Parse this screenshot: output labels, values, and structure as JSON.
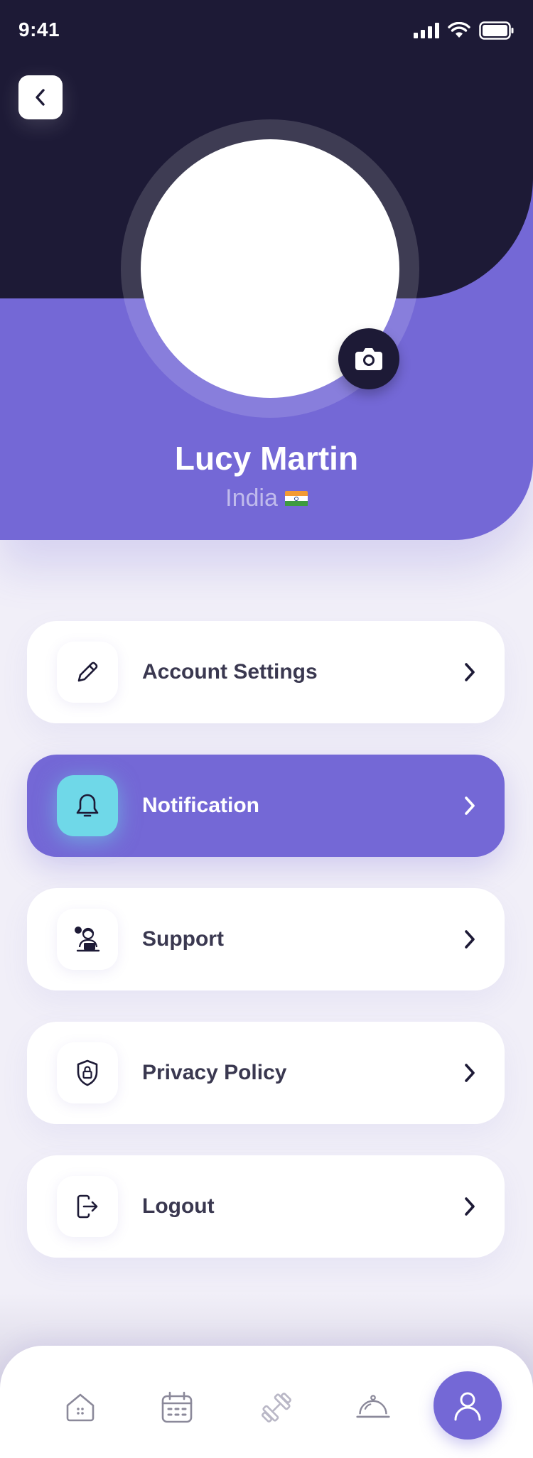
{
  "status_bar": {
    "time": "9:41"
  },
  "profile": {
    "name": "Lucy Martin",
    "country": "India"
  },
  "menu": {
    "items": [
      {
        "label": "Account Settings",
        "icon": "pencil-icon",
        "active": false
      },
      {
        "label": "Notification",
        "icon": "bell-icon",
        "active": true
      },
      {
        "label": "Support",
        "icon": "support-agent-icon",
        "active": false
      },
      {
        "label": "Privacy Policy",
        "icon": "shield-lock-icon",
        "active": false
      },
      {
        "label": "Logout",
        "icon": "logout-icon",
        "active": false
      }
    ]
  },
  "bottom_nav": {
    "items": [
      "home-icon",
      "calendar-icon",
      "dumbbell-icon",
      "food-cloche-icon",
      "profile-icon"
    ],
    "active": "profile-icon"
  },
  "colors": {
    "dark_header": "#1d1a36",
    "accent_purple": "#7468d6",
    "highlight_cyan": "#6fd8e8",
    "background": "#f1eff8",
    "text_dark": "#3a3850"
  }
}
